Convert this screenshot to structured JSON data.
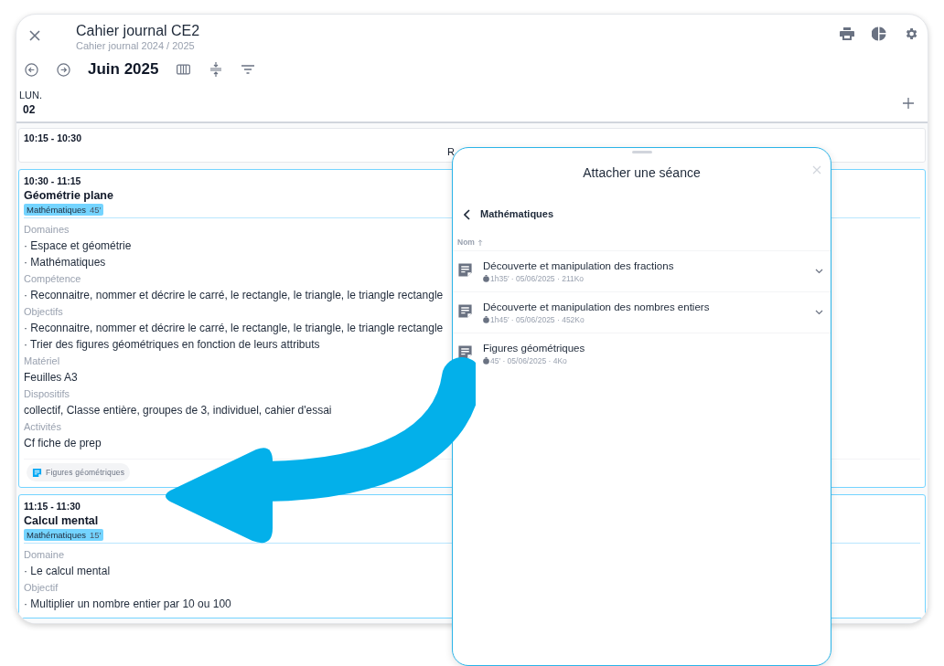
{
  "window": {
    "title": "Cahier journal CE2",
    "subtitle": "Cahier journal 2024 / 2025"
  },
  "toolbar": {
    "month": "Juin 2025"
  },
  "day": {
    "weekday": "LUN.",
    "date": "02"
  },
  "slots": [
    {
      "kind": "simple",
      "time": "10:15 - 10:30",
      "label": "R"
    },
    {
      "kind": "lesson",
      "time": "10:30 - 11:15",
      "title": "Géométrie plane",
      "tag": {
        "subject": "Mathématiques",
        "duration": "45′"
      },
      "sections": [
        {
          "label": "Domaines",
          "lines": [
            "· Espace et géométrie",
            "· Mathématiques"
          ]
        },
        {
          "label": "Compétence",
          "lines": [
            "· Reconnaitre, nommer et décrire le carré, le rectangle, le triangle, le triangle rectangle"
          ]
        },
        {
          "label": "Objectifs",
          "lines": [
            "· Reconnaitre, nommer et décrire le carré, le rectangle, le triangle, le triangle rectangle",
            "· Trier des figures géométriques en fonction de leurs attributs"
          ]
        },
        {
          "label": "Matériel",
          "lines": [
            "Feuilles A3"
          ]
        },
        {
          "label": "Dispositifs",
          "lines": [
            "collectif, Classe entière, groupes de 3, individuel, cahier d'essai"
          ]
        },
        {
          "label": "Activités",
          "lines": [
            "Cf fiche de prep"
          ]
        }
      ],
      "attachments": [
        "Figures géométriques"
      ]
    },
    {
      "kind": "lesson",
      "time": "11:15 - 11:30",
      "title": "Calcul mental",
      "tag": {
        "subject": "Mathématiques",
        "duration": "15′"
      },
      "sections": [
        {
          "label": "Domaine",
          "lines": [
            "· Le calcul mental"
          ]
        },
        {
          "label": "Objectif",
          "lines": [
            "· Multiplier un nombre entier par 10 ou 100"
          ]
        }
      ]
    }
  ],
  "sheet": {
    "title": "Attacher une séance",
    "folder": "Mathématiques",
    "sort_column": "Nom",
    "items": [
      {
        "title": "Découverte et manipulation des fractions",
        "duration": "1h35′",
        "meta": " · 05/06/2025 · 211Ko",
        "expandable": true
      },
      {
        "title": "Découverte et manipulation des nombres entiers",
        "duration": "1h45′",
        "meta": " · 05/06/2025 · 452Ko",
        "expandable": true
      },
      {
        "title": "Figures géométriques",
        "duration": "45′",
        "meta": " · 05/06/2025 · 4Ko",
        "expandable": false
      }
    ]
  }
}
